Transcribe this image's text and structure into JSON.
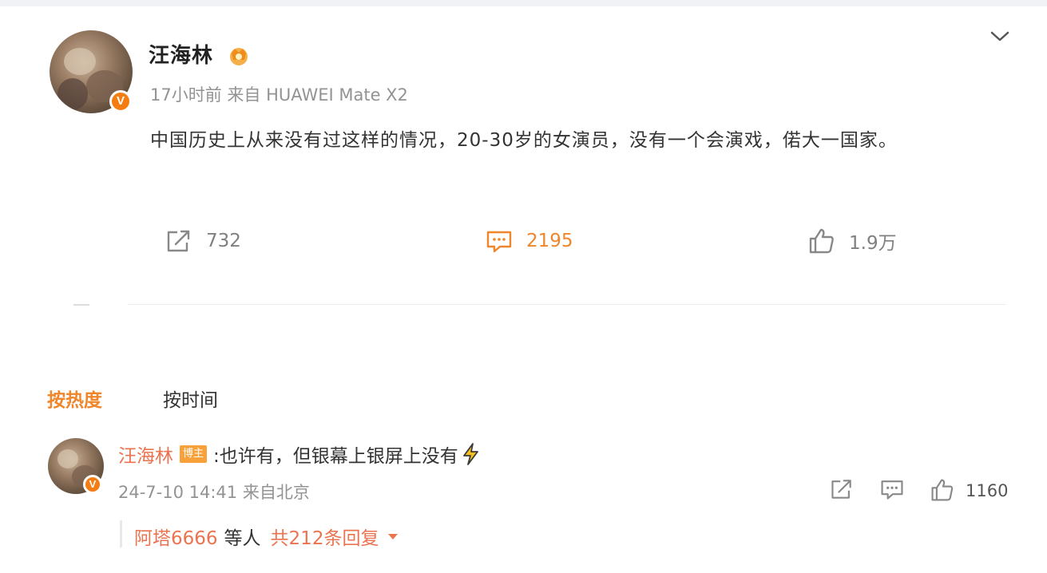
{
  "post": {
    "author": "汪海林",
    "badge_icon": "crown-icon",
    "meta": "17小时前 来自 HUAWEI Mate X2",
    "text": "中国历史上从来没有过这样的情况，20-30岁的女演员，没有一个会演戏，偌大一国家。",
    "verified_mark": "V",
    "actions": {
      "repost_count": "732",
      "comment_count": "2195",
      "like_count": "1.9万"
    }
  },
  "sort_tabs": {
    "hot": "按热度",
    "time": "按时间"
  },
  "comment": {
    "author": "汪海林",
    "host_badge": "博主",
    "text": ":也许有，但银幕上银屏上没有",
    "emoji_icon": "lightning-icon",
    "verified_mark": "V",
    "meta": "24-7-10 14:41 来自北京",
    "like_count": "1160",
    "reply_user": "阿塔6666",
    "reply_mid": "等人",
    "reply_count": "共212条回复"
  },
  "colors": {
    "accent": "#f0862b",
    "username": "#eb7350",
    "host_badge": "#f7a13b",
    "verified": "#f57c10"
  }
}
